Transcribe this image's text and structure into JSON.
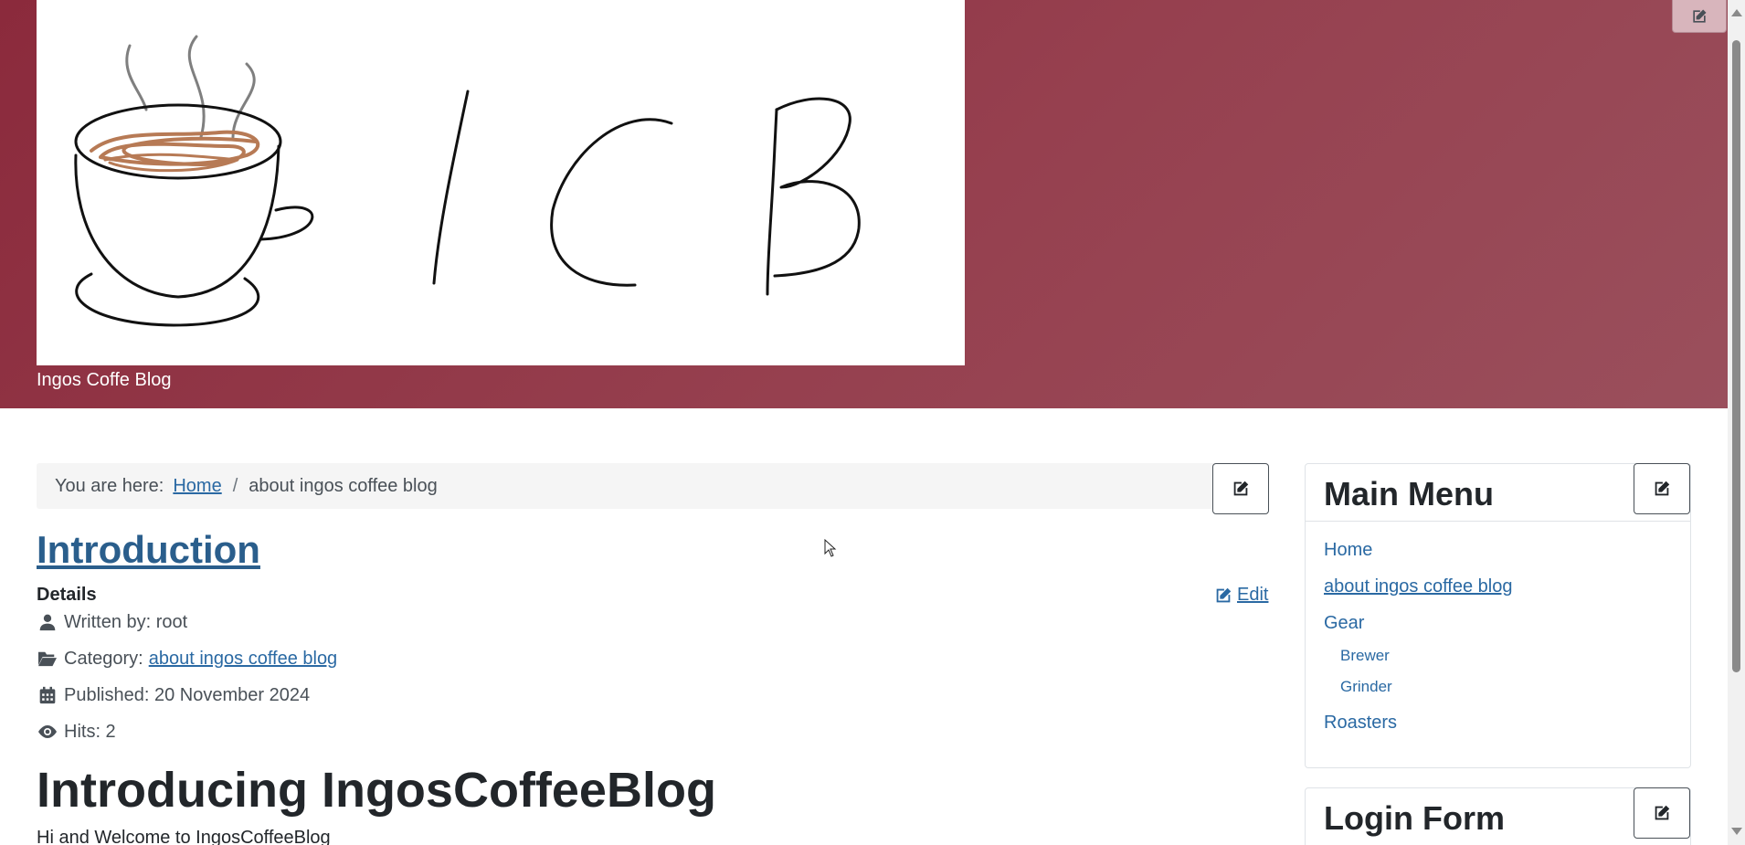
{
  "header": {
    "site_description": "Ingos Coffe Blog",
    "logo_text": "ICB"
  },
  "breadcrumb": {
    "prefix": "You are here:",
    "home": "Home",
    "separator": "/",
    "current": "about ingos coffee blog"
  },
  "article": {
    "title": "Introduction",
    "details_label": "Details",
    "edit_label": "Edit",
    "written_by": "Written by: root",
    "category_prefix": "Category:",
    "category_link": "about ingos coffee blog",
    "published": "Published: 20 November 2024",
    "hits": "Hits: 2",
    "heading": "Introducing IngosCoffeeBlog",
    "intro": "Hi and Welcome to IngosCoffeeBlog"
  },
  "sidebar": {
    "main_menu": {
      "title": "Main Menu",
      "items": [
        {
          "label": "Home"
        },
        {
          "label": "about ingos coffee blog"
        },
        {
          "label": "Gear"
        },
        {
          "label": "Brewer"
        },
        {
          "label": "Grinder"
        },
        {
          "label": "Roasters"
        }
      ]
    },
    "login_form": {
      "title": "Login Form"
    }
  },
  "colors": {
    "header_bg": "#8b2a3c",
    "link": "#2a69a3",
    "title_link": "#2a5e8c"
  }
}
